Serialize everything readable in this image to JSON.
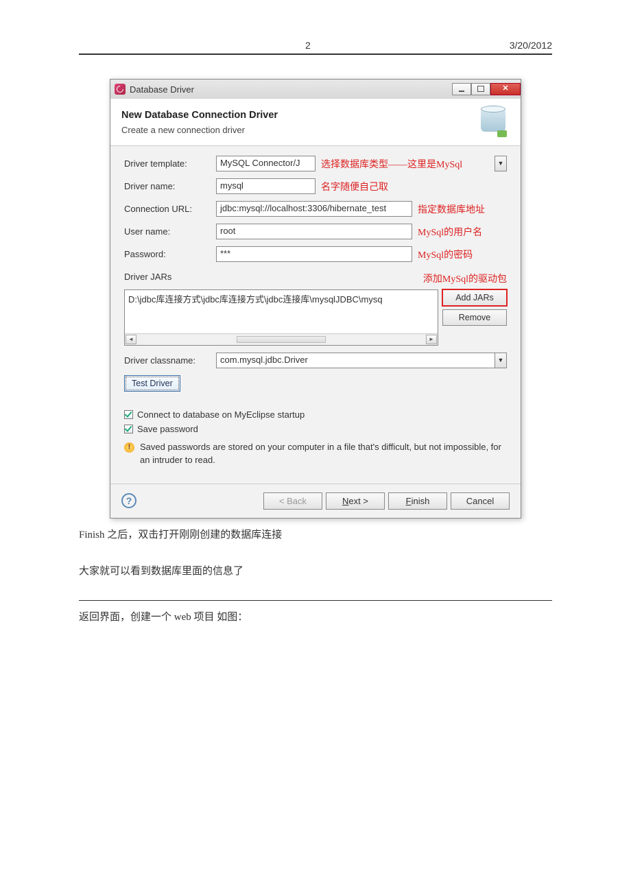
{
  "header": {
    "page_num": "2",
    "date": "3/20/2012"
  },
  "dialog": {
    "title": "Database Driver",
    "banner_title": "New Database Connection Driver",
    "banner_sub": "Create a new connection driver",
    "rows": {
      "template_label": "Driver template:",
      "template_value": "MySQL Connector/J",
      "template_note": "选择数据库类型——这里是MySql",
      "name_label": "Driver name:",
      "name_value": "mysql",
      "name_note": "名字随便自己取",
      "url_label": "Connection URL:",
      "url_value": "jdbc:mysql://localhost:3306/hibernate_test",
      "url_note": "指定数据库地址",
      "user_label": "User name:",
      "user_value": "root",
      "user_note": "MySql的用户名",
      "pass_label": "Password:",
      "pass_value": "***",
      "pass_note": "MySql的密码"
    },
    "jars": {
      "label": "Driver JARs",
      "note": "添加MySql的驱动包",
      "path": "D:\\jdbc库连接方式\\jdbc库连接方式\\jdbc连接库\\mysqlJDBC\\mysq",
      "add": "Add JARs",
      "remove": "Remove"
    },
    "classname_label": "Driver classname:",
    "classname_value": "com.mysql.jdbc.Driver",
    "test_driver": "Test Driver",
    "chk_connect": "Connect to database on MyEclipse startup",
    "chk_save": "Save password",
    "warn": "Saved passwords are stored on your computer in a file that's difficult, but not impossible, for an intruder to read.",
    "buttons": {
      "back": "< Back",
      "next": "Next >",
      "finish": "Finish",
      "cancel": "Cancel"
    }
  },
  "body": {
    "line1": "Finish 之后，双击打开刚刚创建的数据库连接",
    "line2": "大家就可以看到数据库里面的信息了",
    "line3": "返回界面，创建一个 web 项目  如图："
  }
}
